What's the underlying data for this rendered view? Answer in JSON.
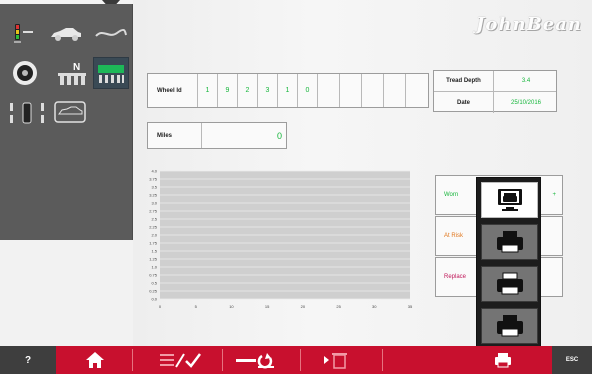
{
  "brand": {
    "name": "JohnBean"
  },
  "wheel_id": {
    "label": "Wheel Id",
    "chars": [
      "1",
      "9",
      "2",
      "3",
      "1",
      "0",
      "",
      "",
      "",
      ""
    ]
  },
  "tread": {
    "depth_label": "Tread Depth",
    "depth_value": "3.4",
    "date_label": "Date",
    "date_value": "25/10/2016"
  },
  "miles": {
    "label": "Miles",
    "value": "0"
  },
  "chart_data": {
    "type": "line",
    "y_ticks": [
      "4.0",
      "3.75",
      "3.5",
      "3.25",
      "3.0",
      "2.75",
      "2.5",
      "2.25",
      "2.0",
      "1.75",
      "1.5",
      "1.25",
      "1.0",
      "0.75",
      "0.5",
      "0.25",
      "0.0"
    ],
    "x_ticks": [
      "0",
      "5",
      "10",
      "15",
      "20",
      "25",
      "30",
      "35"
    ],
    "ylim": [
      0,
      4
    ],
    "xlim": [
      0,
      35
    ],
    "series": []
  },
  "status": {
    "worn_label": "Worn",
    "worn_suffix": "+",
    "at_risk_label": "At Risk",
    "replace_label": "Replace",
    "colors": {
      "worn": "#17b63c",
      "at_risk": "#e0761c",
      "replace": "#c0185a"
    }
  },
  "bottom_bar": {
    "help_label": "?",
    "esc_label": "ESC"
  },
  "icons": {
    "top_arrow": "down-arrow-icon",
    "print_options": [
      "printer-monitor-icon",
      "printer-icon",
      "printer-icon",
      "printer-icon"
    ]
  },
  "colors": {
    "accent": "#c8102e",
    "panel": "#5b5b5b",
    "value_green": "#17b63c"
  }
}
